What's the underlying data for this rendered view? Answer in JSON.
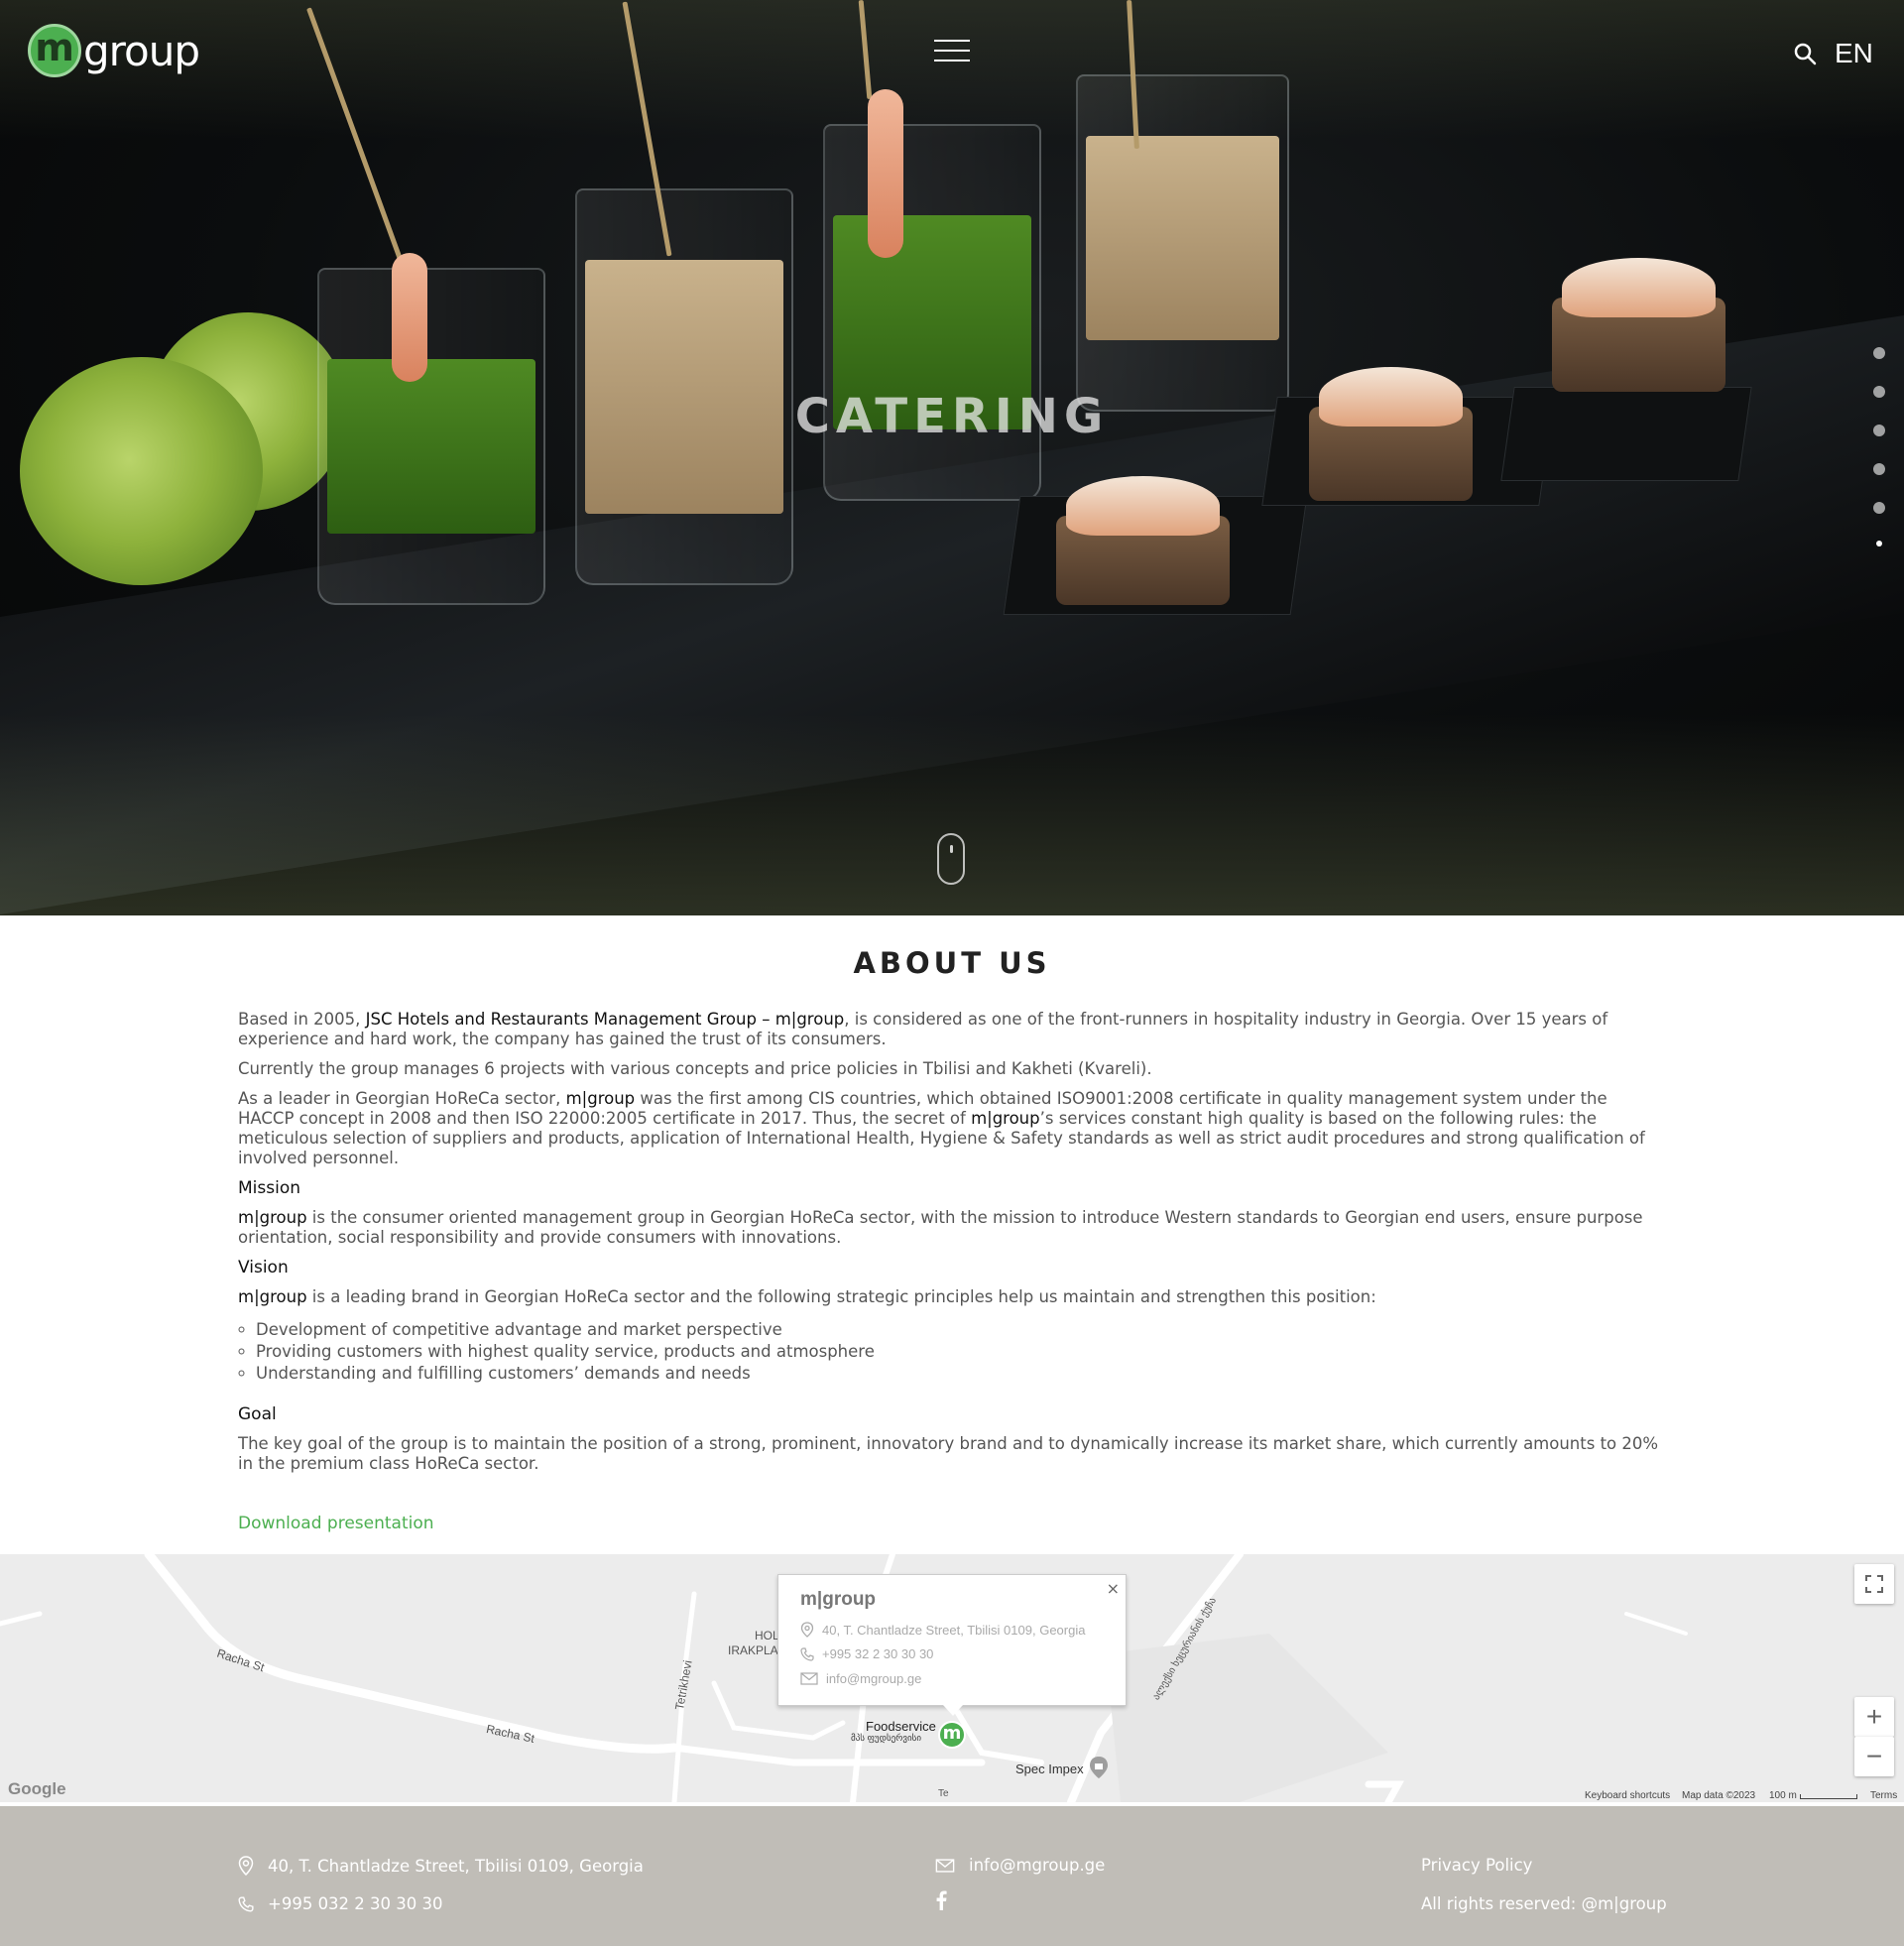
{
  "header": {
    "logo_letter": "m",
    "logo_text": "group",
    "language": "EN"
  },
  "hero": {
    "title": "CATERING",
    "slide_count": 6,
    "active_slide": 6
  },
  "about": {
    "title": "ABOUT US",
    "intro_before": "Based in 2005, ",
    "intro_company": "JSC Hotels and Restaurants Management Group – m|group",
    "intro_after": ", is considered as one of the front-runners in hospitality industry in Georgia. Over 15 years of experience and hard work, the company has gained the trust of its consumers.",
    "projects": "Currently the group manages 6 projects with various concepts and price policies in Tbilisi and Kakheti (Kvareli).",
    "leader_before": "As a leader in Georgian HoReCa sector, ",
    "leader_brand": "m|group",
    "leader_middle": " was the first among CIS countries, which obtained ISO9001:2008 certificate in quality management system under the HACCP concept in 2008 and then ISO 22000:2005 certificate in 2017. Thus, the secret of ",
    "leader_brand2": "m|group",
    "leader_after": "’s services constant high quality is based on the following rules: the meticulous selection of suppliers and products, application of International Health, Hygiene & Safety standards as well as strict audit procedures and strong qualification of involved personnel.",
    "mission_heading": "Mission",
    "mission_brand": "m|group",
    "mission_text": " is the consumer oriented management group in Georgian HoReCa sector, with the mission to introduce Western standards to Georgian end users, ensure purpose orientation, social responsibility and provide consumers with innovations.",
    "vision_heading": "Vision",
    "vision_brand": "m|group",
    "vision_text": " is a leading brand in Georgian HoReCa sector and the following strategic principles help us maintain and strengthen this position:",
    "principles": [
      "Development of competitive advantage and market perspective",
      "Providing customers with highest quality service, products and atmosphere",
      "Understanding and fulfilling customers’ demands and needs"
    ],
    "goal_heading": "Goal",
    "goal_text": "The key goal of the group is to maintain the position of a strong, prominent, innovatory brand and to dynamically increase its market share, which currently amounts to 20% in the premium class HoReCa sector.",
    "download_label": "Download presentation"
  },
  "map": {
    "popup_title": "m|group",
    "popup_address": "40, T. Chantladze Street, Tbilisi 0109, Georgia",
    "popup_phone": "+995 32 2 30 30 30",
    "popup_email": "info@mgroup.ge",
    "close_symbol": "×",
    "labels": {
      "racha1": "Racha St",
      "racha2": "Racha St",
      "tetrikhevi": "Tetrikhevi",
      "hol": "HOL",
      "irakpl": "IRAKPLA",
      "foodservice": "Foodservice",
      "foodservice_ka": "მპს ფუდსერვისი",
      "spec_impex": "Spec Impex",
      "georgian_street": "ალექსი ხეცურიანის ქუჩა",
      "t_label": "Te",
      "marker_letter": "m"
    },
    "zoom_in": "+",
    "zoom_out": "−",
    "google": "Google",
    "keyboard_shortcuts": "Keyboard shortcuts",
    "map_data": "Map data ©2023",
    "scale": "100 m",
    "terms": "Terms"
  },
  "footer": {
    "address": "40, T. Chantladze Street, Tbilisi 0109, Georgia",
    "phone": "+995 032 2 30 30 30",
    "email": "info@mgroup.ge",
    "privacy": "Privacy Policy",
    "rights": "All rights reserved:  @m|group"
  },
  "colors": {
    "accent": "#4caf50",
    "footer_bg": "#c0bdb7",
    "map_bg": "#ececec"
  }
}
